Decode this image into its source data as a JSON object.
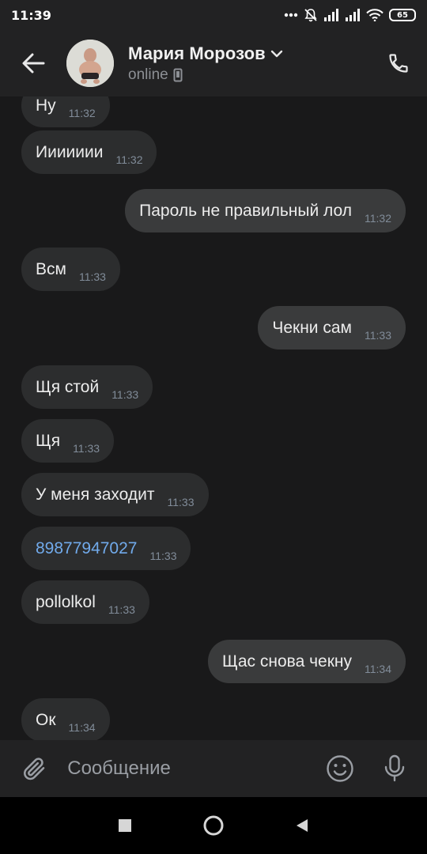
{
  "status_bar": {
    "time": "11:39",
    "battery": "65",
    "icons": [
      "dots-icon",
      "mute-bell-icon",
      "signal-icon",
      "signal-icon",
      "wifi-icon",
      "battery-icon"
    ]
  },
  "header": {
    "contact_name": "Мария Морозов",
    "status": "online",
    "icons": {
      "back": "arrow-left-icon",
      "expand": "chevron-down-icon",
      "device": "phone-device-icon",
      "call": "phone-call-icon"
    }
  },
  "messages": [
    {
      "dir": "in",
      "text": "Ну",
      "time": "11:32"
    },
    {
      "dir": "in",
      "text": "Иииииии",
      "time": "11:32"
    },
    {
      "dir": "out",
      "text": "Пароль не правильный лол",
      "time": "11:32"
    },
    {
      "dir": "in",
      "text": "Всм",
      "time": "11:33"
    },
    {
      "dir": "out",
      "text": "Чекни сам",
      "time": "11:33"
    },
    {
      "dir": "in",
      "text": "Щя стой",
      "time": "11:33"
    },
    {
      "dir": "in",
      "text": "Щя",
      "time": "11:33"
    },
    {
      "dir": "in",
      "text": "У меня заходит",
      "time": "11:33"
    },
    {
      "dir": "in",
      "text": "89877947027",
      "time": "11:33",
      "link": true
    },
    {
      "dir": "in",
      "text": "pollolkol",
      "time": "11:33"
    },
    {
      "dir": "out",
      "text": "Щас снова чекну",
      "time": "11:34"
    },
    {
      "dir": "in",
      "text": "Ок",
      "time": "11:34"
    }
  ],
  "composer": {
    "placeholder": "Сообщение",
    "value": ""
  },
  "colors": {
    "background": "#19191a",
    "bar": "#222223",
    "bubble_in": "#2c2d2e",
    "bubble_out": "#3a3b3c",
    "link": "#71aaeb"
  }
}
